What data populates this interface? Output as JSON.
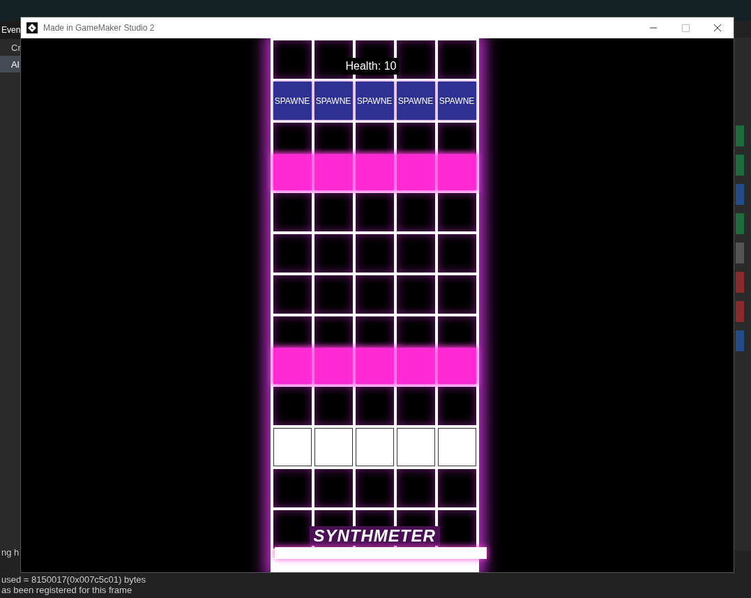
{
  "background": {
    "left_tab": "Even",
    "events": [
      {
        "label": "Cr",
        "selected": false
      },
      {
        "label": "Al",
        "selected": true
      }
    ],
    "output_lines": [
      "ng h",
      "used = 8150017(0x007c5c01) bytes",
      "as been registered for this frame"
    ]
  },
  "window": {
    "title": "Made in GameMaker Studio 2"
  },
  "game": {
    "health": "Health: 10",
    "logo": "SYNTHMETER",
    "bar": {
      "level": 1
    },
    "rows": [
      {
        "kind": "empty"
      },
      {
        "kind": "spawner",
        "cells": [
          "SPAWNE",
          "SPAWNE",
          "SPAWNE",
          "SPAWNE",
          "SPAWNE"
        ]
      },
      {
        "kind": "empty"
      },
      {
        "kind": "notes"
      },
      {
        "kind": "empty"
      },
      {
        "kind": "empty"
      },
      {
        "kind": "empty"
      },
      {
        "kind": "empty"
      },
      {
        "kind": "notes"
      },
      {
        "kind": "empty"
      },
      {
        "kind": "target"
      },
      {
        "kind": "empty"
      },
      {
        "kind": "empty"
      }
    ]
  }
}
